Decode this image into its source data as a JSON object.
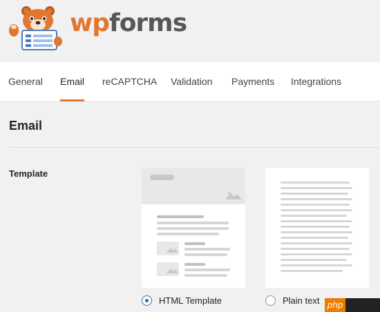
{
  "brand": {
    "logo_wp": "wp",
    "logo_forms": "forms",
    "accent": "#e27730"
  },
  "tabs": [
    {
      "label": "General",
      "active": false
    },
    {
      "label": "Email",
      "active": true
    },
    {
      "label": "reCAPTCHA",
      "active": false
    },
    {
      "label": "Validation",
      "active": false
    },
    {
      "label": "Payments",
      "active": false
    },
    {
      "label": "Integrations",
      "active": false
    }
  ],
  "section": {
    "title": "Email",
    "template_label": "Template"
  },
  "template_options": [
    {
      "label": "HTML Template",
      "selected": true,
      "icon": "html-template-preview"
    },
    {
      "label": "Plain text",
      "selected": false,
      "icon": "plain-text-preview"
    }
  ],
  "watermark": {
    "text": "php"
  }
}
